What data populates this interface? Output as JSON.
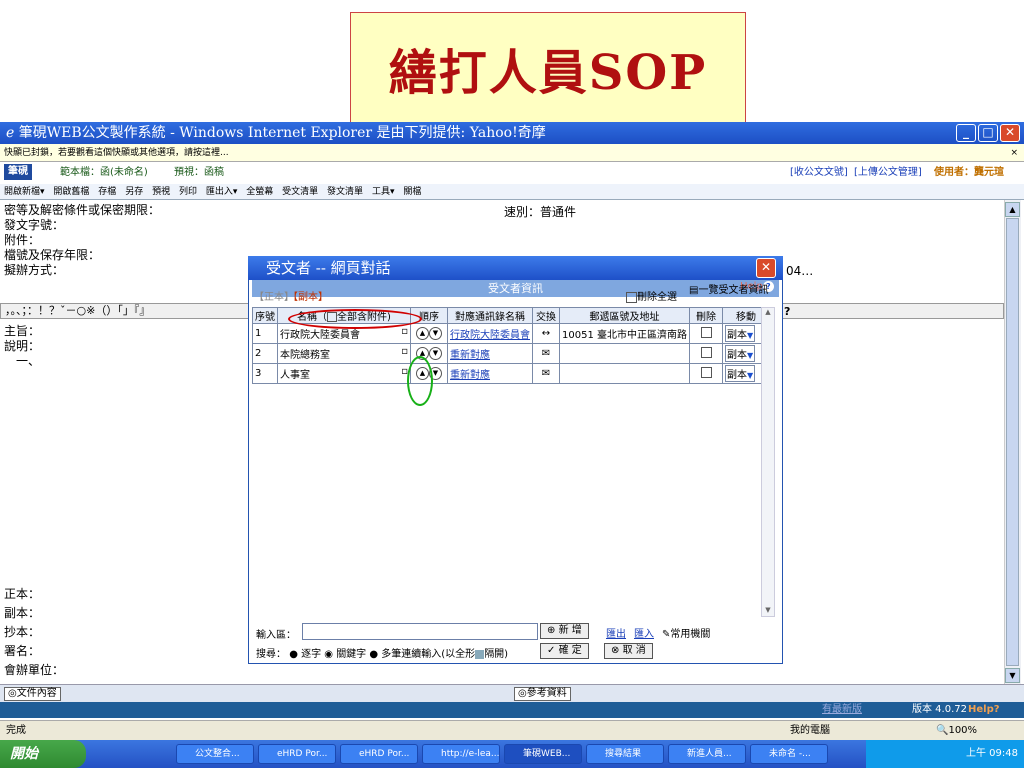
{
  "slide": {
    "title": "繕打人員SOP"
  },
  "window": {
    "title": "筆硯WEB公文製作系統 - Windows Internet Explorer 是由下列提供: Yahoo!奇摩"
  },
  "infobar": {
    "text": "快顯已封鎖，若要觀看這個快顯或其他選項，請按這裡..."
  },
  "appbar": {
    "logo": "筆硯",
    "draft": "範本檔：函(未命名)",
    "preview": "預視：函稿",
    "link_receive": "[收公文文號]",
    "link_upload": "[上傳公文管理]",
    "user": "使用者：龔元瑄"
  },
  "toolbar": {
    "items": [
      "開啟新檔▾",
      "開啟舊檔",
      "存檔",
      "另存",
      "預視",
      "列印",
      "匯出入▾",
      "全螢幕",
      "受文清單",
      "發文清單",
      "工具▾",
      "關檔"
    ]
  },
  "form": {
    "top": [
      "密等及解密條件或保密期限：",
      "發文字號：",
      "附件：",
      "檔號及保存年限：",
      "擬辦方式："
    ],
    "speed": "速別：普通件",
    "right_num": "04…",
    "punct": "，。、；：！？ˇ－○※（）「」『』",
    "q": "?",
    "main": [
      "主旨：",
      "說明：",
      "　一、"
    ],
    "bottom": [
      "正本：",
      "副本：",
      "抄本：",
      "署名：",
      "會辦單位："
    ]
  },
  "dialog": {
    "title": "受文者 -- 網頁對話",
    "header": "受文者資訊",
    "help": "Help",
    "tabs": {
      "original": "【正本】",
      "copy": "【副本】"
    },
    "delete_all": "刪除全選",
    "list_link": "一覽受文者資訊",
    "columns": [
      "序號",
      "名稱（",
      "全部含附件)",
      "順序",
      "對應通訊錄名稱",
      "交換",
      "郵遞區號及地址",
      "刪除",
      "移動"
    ],
    "rows": [
      {
        "no": "1",
        "name": "行政院大陸委員會",
        "mapped": "行政院大陸委員會",
        "exchange": "↔",
        "zip": "10051",
        "addr": "臺北市中正區濟南路",
        "move": "副本"
      },
      {
        "no": "2",
        "name": "本院總務室",
        "mapped": "重新對應",
        "exchange": "✉",
        "zip": "",
        "addr": "",
        "move": "副本"
      },
      {
        "no": "3",
        "name": "人事室",
        "mapped": "重新對應",
        "exchange": "✉",
        "zip": "",
        "addr": "",
        "move": "副本"
      }
    ],
    "input_label": "輸入區：",
    "search_label": "搜尋：",
    "search_opts": [
      "逐字",
      "關鍵字",
      "多筆連續輸入(以全形",
      "隔開)"
    ],
    "btn_add": "新 增",
    "btn_ok": "確 定",
    "btn_cancel": "取 消",
    "export": "匯出",
    "import": "匯入",
    "common": "常用機關"
  },
  "bottom": {
    "doc_content": "文件內容",
    "reference": "參考資料"
  },
  "version": {
    "update": "有最新版",
    "text": "版本 4.0.72",
    "help": "Help?"
  },
  "status": {
    "done": "完成",
    "zone": "我的電腦",
    "zoom": "100%"
  },
  "taskbar": {
    "start": "開始",
    "tasks": [
      "公文整合...",
      "eHRD Por...",
      "eHRD Por...",
      "http://e-lea...",
      "筆硯WEB...",
      "搜尋結果",
      "新進人員...",
      "未命名 -..."
    ],
    "clock": "上午 09:48"
  },
  "colors": {
    "xp_blue": "#1d4fc4",
    "slide_red": "#b01010",
    "annot_red": "#d00000",
    "annot_green": "#18b018"
  }
}
